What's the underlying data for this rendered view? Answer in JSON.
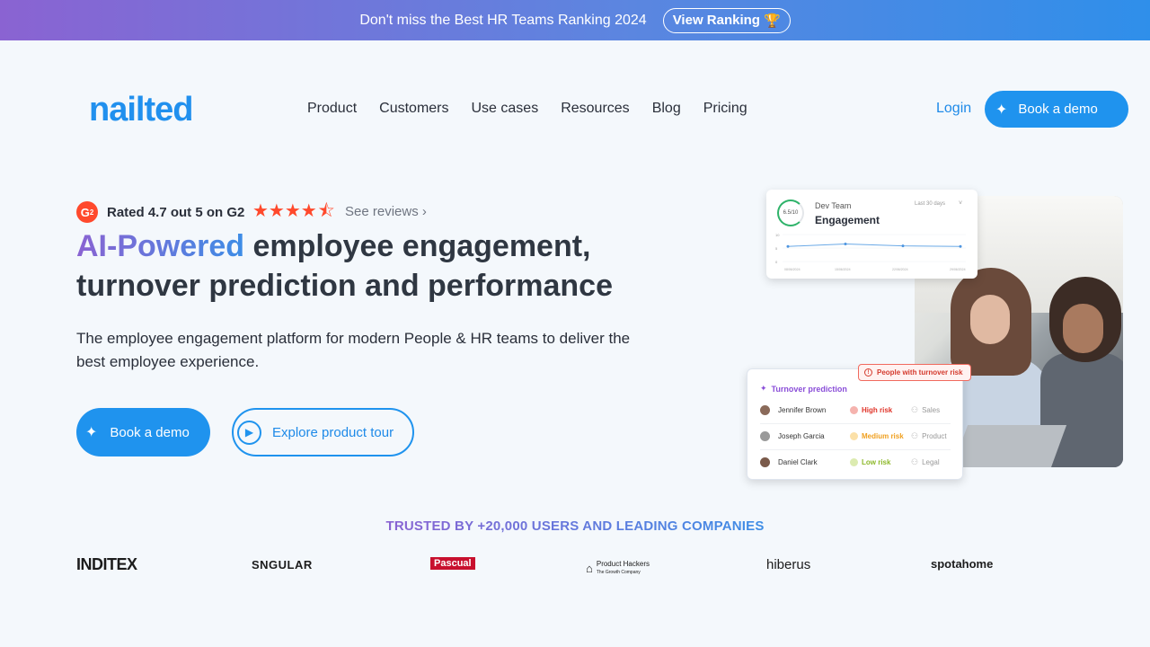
{
  "banner": {
    "message": "Don't miss the Best HR Teams Ranking 2024",
    "button_label": "View Ranking",
    "button_icon": "🏆"
  },
  "header": {
    "logo": "nailted",
    "nav": [
      "Product",
      "Customers",
      "Use cases",
      "Resources",
      "Blog",
      "Pricing"
    ],
    "login": "Login",
    "demo_button": "Book a demo"
  },
  "hero": {
    "g2_badge": "2",
    "rating_text": "Rated 4.7 out 5 on G2",
    "rating_value": 4.7,
    "rating_max": 5,
    "stars": "★★★★",
    "half_star": "⯪",
    "see_reviews": "See reviews ›",
    "headline_highlight": "AI-Powered",
    "headline_rest_1": " employee engagement,",
    "headline_rest_2": "turnover prediction and performance",
    "subtitle": "The employee engagement platform for modern People & HR teams to deliver the best employee experience.",
    "cta_demo": "Book a demo",
    "cta_tour": "Explore product tour"
  },
  "engagement_card": {
    "score": "6.5/10",
    "team": "Dev Team",
    "title": "Engagement",
    "period": "Last 30 days",
    "close": "˅",
    "y_ticks": [
      "10",
      "5",
      "0"
    ],
    "x_dates": [
      "08/06/2024",
      "15/06/2024",
      "22/06/2024",
      "29/06/2024"
    ],
    "values": [
      5.6,
      6.5,
      5.8,
      5.6
    ]
  },
  "turnover_card": {
    "badge": "People with turnover risk",
    "title": "Turnover prediction",
    "rows": [
      {
        "name": "Jennifer Brown",
        "risk": "High risk",
        "dept": "Sales"
      },
      {
        "name": "Joseph Garcia",
        "risk": "Medium risk",
        "dept": "Product"
      },
      {
        "name": "Daniel Clark",
        "risk": "Low risk",
        "dept": "Legal"
      }
    ]
  },
  "colors": {
    "accent": "#1f93ee",
    "high_risk": "#e0352a",
    "medium_risk": "#f0a020",
    "low_risk": "#8db82a"
  },
  "trusted": {
    "title": "TRUSTED BY +20,000 USERS AND LEADING COMPANIES",
    "logos": [
      "INDITEX",
      "SNGULAR",
      "Pascual",
      "Product Hackers",
      "hiberus",
      "spotahome"
    ],
    "logo_subtitle": "The Growth Company"
  }
}
